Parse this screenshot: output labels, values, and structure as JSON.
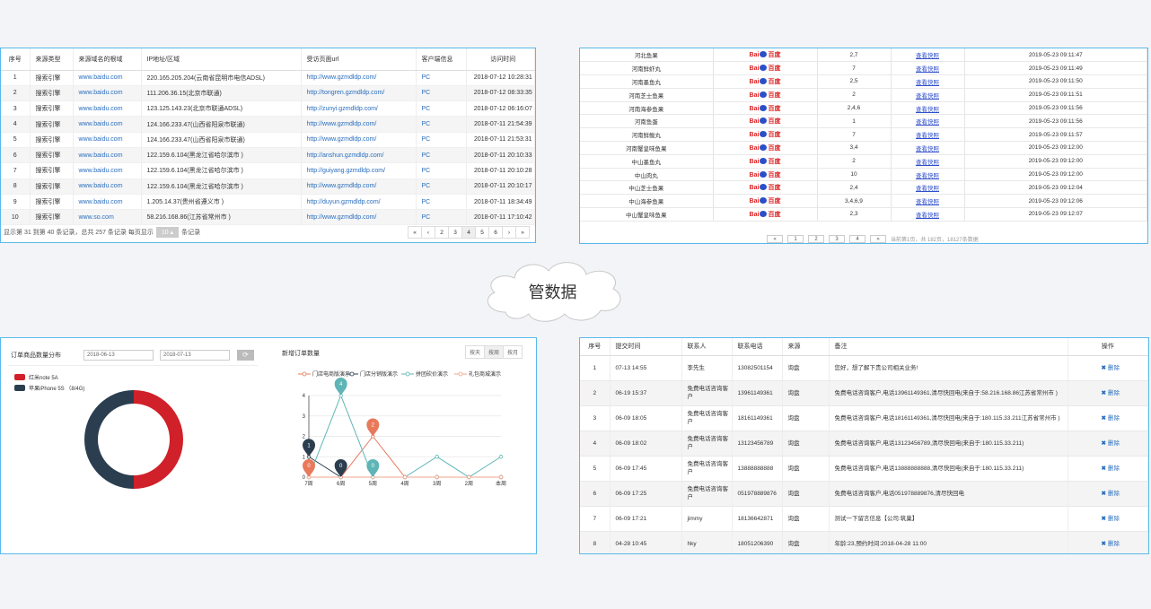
{
  "visit_log": {
    "headers": [
      "序号",
      "来源类型",
      "来源域名的根域",
      "IP地址/区域",
      "受访页面url",
      "客户端信息",
      "访问时间"
    ],
    "rows": [
      [
        "1",
        "搜索引擎",
        "www.baidu.com",
        "220.165.205.204(云南省昆明市电信ADSL)",
        "http://www.gzmdldp.com/",
        "PC",
        "2018-07-12 10:28:31"
      ],
      [
        "2",
        "搜索引擎",
        "www.baidu.com",
        "111.206.36.15(北京市联通)",
        "http://tongren.gzmdldp.com/",
        "PC",
        "2018-07-12 08:33:35"
      ],
      [
        "3",
        "搜索引擎",
        "www.baidu.com",
        "123.125.143.23(北京市联通ADSL)",
        "http://zunyi.gzmdldp.com/",
        "PC",
        "2018-07-12 06:16:07"
      ],
      [
        "4",
        "搜索引擎",
        "www.baidu.com",
        "124.166.233.47(山西省阳泉市联通)",
        "http://www.gzmdldp.com/",
        "PC",
        "2018-07-11 21:54:39"
      ],
      [
        "5",
        "搜索引擎",
        "www.baidu.com",
        "124.166.233.47(山西省阳泉市联通)",
        "http://www.gzmdldp.com/",
        "PC",
        "2018-07-11 21:53:31"
      ],
      [
        "6",
        "搜索引擎",
        "www.baidu.com",
        "122.159.6.104(黑龙江省哈尔滨市 )",
        "http://anshun.gzmdldp.com/",
        "PC",
        "2018-07-11 20:10:33"
      ],
      [
        "7",
        "搜索引擎",
        "www.baidu.com",
        "122.159.6.104(黑龙江省哈尔滨市 )",
        "http://guiyang.gzmdldp.com/",
        "PC",
        "2018-07-11 20:10:28"
      ],
      [
        "8",
        "搜索引擎",
        "www.baidu.com",
        "122.159.6.104(黑龙江省哈尔滨市 )",
        "http://www.gzmdldp.com/",
        "PC",
        "2018-07-11 20:10:17"
      ],
      [
        "9",
        "搜索引擎",
        "www.baidu.com",
        "1.205.14.37(贵州省遵义市 )",
        "http://duyun.gzmdldp.com/",
        "PC",
        "2018-07-11 18:34:49"
      ],
      [
        "10",
        "搜索引擎",
        "www.so.com",
        "58.216.168.86(江苏省常州市 )",
        "http://www.gzmdldp.com/",
        "PC",
        "2018-07-11 17:10:42"
      ]
    ],
    "footer_info": "显示第 31 到第 40 条记录，总共 257 条记录 每页显示",
    "page_size": "10 ▴",
    "footer_suffix": "条记录",
    "pager": [
      "«",
      "‹",
      "2",
      "3",
      "4",
      "5",
      "6",
      "›",
      "»"
    ]
  },
  "keyword_rank": {
    "rows": [
      [
        "河北鱼果",
        "2,7",
        "查看快照",
        "2019-05-23 09:11:47"
      ],
      [
        "河南鲜虾丸",
        "7",
        "查看快照",
        "2019-05-23 09:11:49"
      ],
      [
        "河南墨鱼丸",
        "2,5",
        "查看快照",
        "2019-05-23 09:11:50"
      ],
      [
        "河南芝士鱼果",
        "2",
        "查看快照",
        "2019-05-23 09:11:51"
      ],
      [
        "河南海参鱼果",
        "2,4,6",
        "查看快照",
        "2019-05-23 09:11:56"
      ],
      [
        "河南鱼蛋",
        "1",
        "查看快照",
        "2019-05-23 09:11:56"
      ],
      [
        "河南鲜鲅丸",
        "7",
        "查看快照",
        "2019-05-23 09:11:57"
      ],
      [
        "河南蟹皇味鱼果",
        "3,4",
        "查看快照",
        "2019-05-23 09:12:00"
      ],
      [
        "中山墨鱼丸",
        "2",
        "查看快照",
        "2019-05-23 09:12:00"
      ],
      [
        "中山肉丸",
        "10",
        "查看快照",
        "2019-05-23 09:12:00"
      ],
      [
        "中山芝士鱼果",
        "2,4",
        "查看快照",
        "2019-05-23 09:12:04"
      ],
      [
        "中山海参鱼果",
        "3,4,6,9",
        "查看快照",
        "2019-05-23 09:12:06"
      ],
      [
        "中山蟹皇味鱼果",
        "2,3",
        "查看快照",
        "2019-05-23 09:12:07"
      ]
    ],
    "baidu_left": "Bai",
    "baidu_right": "百度",
    "pager": [
      "«",
      "1",
      "2",
      "3",
      "4",
      "»"
    ],
    "summary": "当前第1页，共 182页，18127条数据"
  },
  "center_label": "管数据",
  "product_chart": {
    "title": "订单商品数量分布",
    "date_from": "2018-06-13",
    "date_to": "2018-07-13",
    "refresh_icon": "refresh-icon",
    "legend": [
      {
        "name": "红米note 5A",
        "color": "#d0202a"
      },
      {
        "name": "苹果iPhone 5S （8/4G)",
        "color": "#2b3e50"
      }
    ]
  },
  "chart_data": [
    {
      "type": "pie",
      "title": "订单商品数量分布",
      "labels": [
        "红米note 5A",
        "苹果iPhone 5S （8/4G)"
      ],
      "values": [
        50,
        50
      ],
      "colors": [
        "#d0202a",
        "#2b3e50"
      ],
      "donut": true
    },
    {
      "type": "line",
      "title": "新增订单数量",
      "categories": [
        "7周",
        "6周",
        "5周",
        "4周",
        "3周",
        "2周",
        "本周"
      ],
      "ylim": [
        0,
        4
      ],
      "yticks": [
        "0",
        "1",
        "2",
        "3",
        "4"
      ],
      "grid": true,
      "legend_position": "top",
      "series": [
        {
          "name": "门店电商版演示",
          "color": "#e8795b",
          "values": [
            0,
            0,
            2,
            0,
            0,
            0,
            0
          ]
        },
        {
          "name": "门店分销版演示",
          "color": "#2b3e50",
          "values": [
            1,
            0,
            0,
            0,
            0,
            0,
            0
          ]
        },
        {
          "name": "拼团砍价演示",
          "color": "#5fb5b5",
          "values": [
            0,
            4,
            0,
            0,
            1,
            0,
            1
          ]
        },
        {
          "name": "礼包商城演示",
          "color": "#f2a48b",
          "values": [
            0,
            0,
            0,
            0,
            0,
            0,
            0
          ]
        }
      ],
      "markers": [
        {
          "series": 0,
          "index": 0,
          "label": "0"
        },
        {
          "series": 1,
          "index": 0,
          "label": "1"
        },
        {
          "series": 2,
          "index": 1,
          "label": "4"
        },
        {
          "series": 1,
          "index": 1,
          "label": "0"
        },
        {
          "series": 0,
          "index": 2,
          "label": "2"
        },
        {
          "series": 2,
          "index": 2,
          "label": "0"
        }
      ]
    }
  ],
  "order_chart": {
    "title": "新增订单数量",
    "tabs": [
      "按天",
      "按周",
      "按月"
    ],
    "active_tab": 1
  },
  "messages": {
    "headers": [
      "序号",
      "提交时间",
      "联系人",
      "联系电话",
      "来源",
      "备注",
      "操作"
    ],
    "delete_label": "删除",
    "rows": [
      [
        "1",
        "07-13 14:55",
        "李先生",
        "13082501154",
        "询盘",
        "您好，想了解下贵公司相关业务!"
      ],
      [
        "2",
        "06-19 15:37",
        "免费电话咨询客户",
        "13961149361",
        "询盘",
        "免费电话咨询客户,电话13961149361,清尽快回电(来自于:58.216.168.86江苏省常州市 )"
      ],
      [
        "3",
        "06-09 18:05",
        "免费电话咨询客户",
        "18161149361",
        "询盘",
        "免费电话咨询客户,电话18161149361,清尽快回电(来自于:180.115.33.211江苏省常州市 )"
      ],
      [
        "4",
        "06-09 18:02",
        "免费电话咨询客户",
        "13123456789",
        "询盘",
        "免费电话咨询客户,电话13123456789,清尽快回电(来自于:180.115.33.211)"
      ],
      [
        "5",
        "06-09 17:45",
        "免费电话咨询客户",
        "13888888888",
        "询盘",
        "免费电话咨询客户,电话13888888888,清尽快回电(来自于:180.115.33.211)"
      ],
      [
        "6",
        "06-09 17:25",
        "免费电话咨询客户",
        "051978889876",
        "询盘",
        "免费电话咨询客户,电话051978889876,清尽快回电"
      ],
      [
        "7",
        "06-09 17:21",
        "jimmy",
        "18136642871",
        "询盘",
        "测试一下留言信息【公司:筑巢】"
      ],
      [
        "8",
        "04-28 10:45",
        "hky",
        "18051206390",
        "询盘",
        "年龄:23,预约时间:2018-04-28 11:00"
      ]
    ]
  }
}
